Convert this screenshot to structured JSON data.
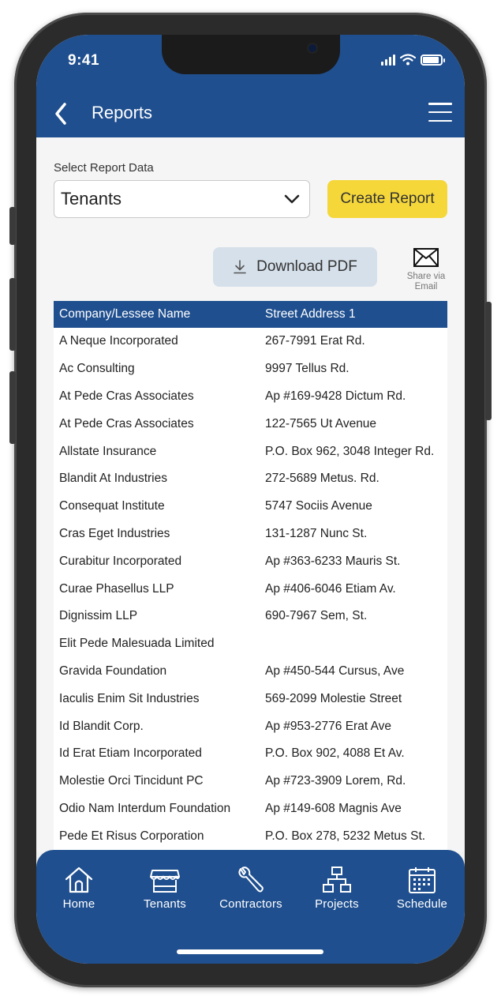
{
  "status_bar": {
    "time": "9:41"
  },
  "header": {
    "title": "Reports"
  },
  "report_form": {
    "select_label": "Select Report Data",
    "selected_value": "Tenants",
    "create_button": "Create Report",
    "download_button": "Download PDF",
    "share_label_line1": "Share via",
    "share_label_line2": "Email"
  },
  "table": {
    "headers": [
      "Company/Lessee Name",
      "Street Address 1"
    ],
    "rows": [
      [
        "A Neque Incorporated",
        "267-7991 Erat Rd."
      ],
      [
        "Ac Consulting",
        "9997 Tellus Rd."
      ],
      [
        "At Pede Cras Associates",
        "Ap #169-9428 Dictum Rd."
      ],
      [
        "At Pede Cras Associates",
        "122-7565 Ut Avenue"
      ],
      [
        "Allstate Insurance",
        "P.O. Box 962, 3048 Integer Rd."
      ],
      [
        "Blandit At Industries",
        "272-5689 Metus. Rd."
      ],
      [
        "Consequat Institute",
        "5747 Sociis Avenue"
      ],
      [
        "Cras Eget Industries",
        "131-1287 Nunc St."
      ],
      [
        "Curabitur Incorporated",
        "Ap #363-6233 Mauris St."
      ],
      [
        "Curae Phasellus LLP",
        "Ap #406-6046 Etiam Av."
      ],
      [
        "Dignissim LLP",
        "690-7967 Sem, St."
      ],
      [
        "Elit Pede Malesuada Limited",
        ""
      ],
      [
        "Gravida Foundation",
        "Ap #450-544 Cursus, Ave"
      ],
      [
        "Iaculis Enim Sit Industries",
        "569-2099 Molestie Street"
      ],
      [
        "Id Blandit Corp.",
        "Ap #953-2776 Erat Ave"
      ],
      [
        "Id Erat Etiam Incorporated",
        "P.O. Box 902, 4088 Et Av."
      ],
      [
        "Molestie Orci Tincidunt PC",
        "Ap #723-3909 Lorem, Rd."
      ],
      [
        "Odio Nam Interdum Foundation",
        "Ap #149-608 Magnis Ave"
      ],
      [
        "Pede Et Risus Corporation",
        "P.O. Box 278, 5232 Metus St."
      ],
      [
        "",
        ""
      ]
    ]
  },
  "bottom_nav": {
    "tabs": [
      {
        "label": "Home",
        "icon": "home-icon"
      },
      {
        "label": "Tenants",
        "icon": "storefront-icon"
      },
      {
        "label": "Contractors",
        "icon": "wrench-icon"
      },
      {
        "label": "Projects",
        "icon": "org-chart-icon"
      },
      {
        "label": "Schedule",
        "icon": "calendar-icon"
      }
    ]
  },
  "colors": {
    "brand_blue": "#1f4f8f",
    "accent_yellow": "#f5d73a",
    "download_bg": "#d5e0ea"
  }
}
